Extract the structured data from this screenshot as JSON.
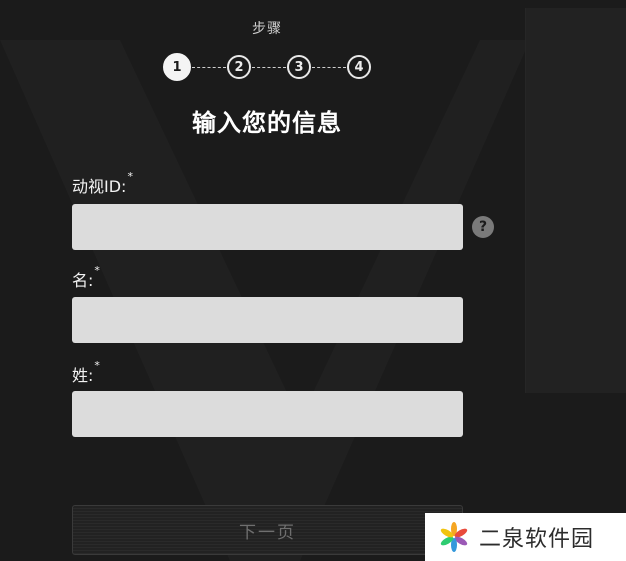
{
  "steps": {
    "title": "步骤",
    "items": [
      "1",
      "2",
      "3",
      "4"
    ],
    "active_index": 1
  },
  "page_title": "输入您的信息",
  "fields": {
    "activision_id": {
      "label": "动视ID:",
      "required_mark": "*",
      "value": "",
      "help_symbol": "?"
    },
    "first_name": {
      "label": "名:",
      "required_mark": "*",
      "value": ""
    },
    "last_name": {
      "label": "姓:",
      "required_mark": "*",
      "value": ""
    }
  },
  "next_button": {
    "label": "下一页",
    "enabled": false
  },
  "watermark": {
    "text": "二泉软件园",
    "icon": "pinwheel-logo-icon"
  },
  "colors": {
    "background": "#1b1b1b",
    "input_bg": "#dcdcdc",
    "text": "#ffffff",
    "button_text_disabled": "#6f6f6f"
  }
}
